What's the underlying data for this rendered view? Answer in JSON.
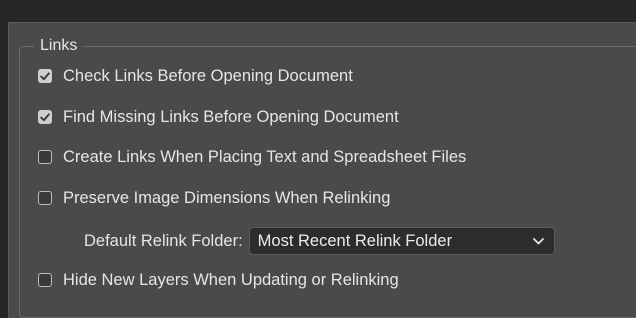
{
  "section": {
    "title": "Links"
  },
  "options": [
    {
      "label": "Check Links Before Opening Document",
      "checked": true
    },
    {
      "label": "Find Missing Links Before Opening Document",
      "checked": true
    },
    {
      "label": "Create Links When Placing Text and Spreadsheet Files",
      "checked": false
    },
    {
      "label": "Preserve Image Dimensions When Relinking",
      "checked": false
    },
    {
      "label": "Hide New Layers When Updating or Relinking",
      "checked": false
    }
  ],
  "relink": {
    "label": "Default Relink Folder:",
    "selected": "Most Recent Relink Folder"
  },
  "icons": {
    "checkmark": "checkmark-icon",
    "dropdown": "chevron-down-icon"
  },
  "colors": {
    "background": "#262626",
    "panel": "#4a4a4a",
    "text": "#e6e6e6",
    "checkbox_checked": "#cfcfcf",
    "select_bg": "#2c2c2c"
  }
}
